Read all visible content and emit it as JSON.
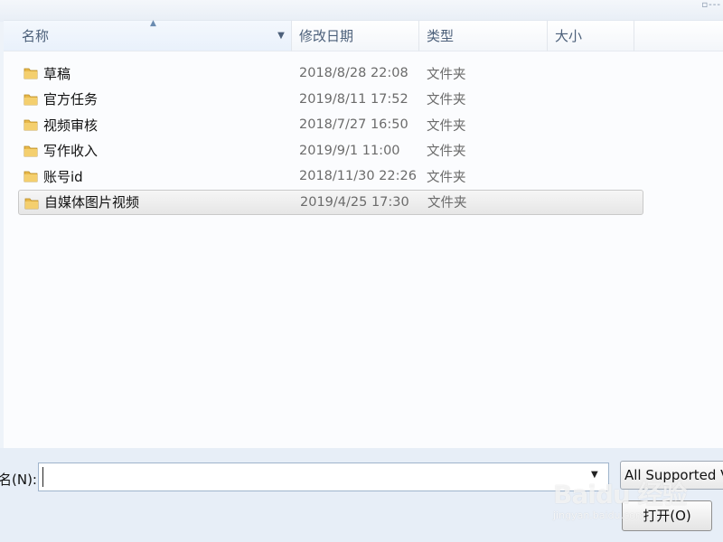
{
  "top_bar": {
    "corner_glyph": "▫---"
  },
  "columns": {
    "name": "名称",
    "date_modified": "修改日期",
    "type": "类型",
    "size": "大小"
  },
  "rows": [
    {
      "name": "草稿",
      "date": "2018/8/28 22:08",
      "type": "文件夹"
    },
    {
      "name": "官方任务",
      "date": "2019/8/11 17:52",
      "type": "文件夹"
    },
    {
      "name": "视频审核",
      "date": "2018/7/27 16:50",
      "type": "文件夹"
    },
    {
      "name": "写作收入",
      "date": "2019/9/1 11:00",
      "type": "文件夹"
    },
    {
      "name": "账号id",
      "date": "2018/11/30 22:26",
      "type": "文件夹"
    },
    {
      "name": "自媒体图片视频",
      "date": "2019/4/25 17:30",
      "type": "文件夹",
      "selected": true
    }
  ],
  "bottom": {
    "filename_label": "名(N):",
    "filename_value": "",
    "file_type": "All Supported V",
    "open_button": "打开(O)"
  },
  "watermark": {
    "logo": "Baidu 经验",
    "sub": "jingyan.baidu.com"
  },
  "colors": {
    "folder": "#e8b84a",
    "selected_row": "#e6e6e6",
    "header_text": "#4c607a"
  }
}
